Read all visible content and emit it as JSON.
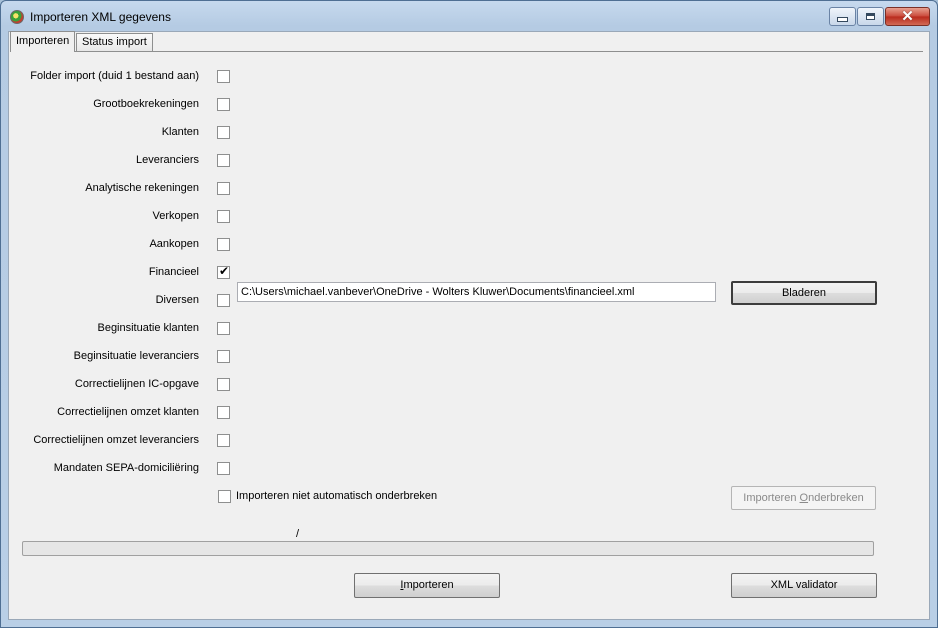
{
  "window": {
    "title": "Importeren XML gegevens",
    "icon": "app-globe-icon"
  },
  "tabs": [
    {
      "label": "Importeren",
      "active": true
    },
    {
      "label": "Status import",
      "active": false
    }
  ],
  "import_options": [
    {
      "label": "Folder import (duid 1 bestand aan)",
      "checked": false
    },
    {
      "label": "Grootboekrekeningen",
      "checked": false
    },
    {
      "label": "Klanten",
      "checked": false
    },
    {
      "label": "Leveranciers",
      "checked": false
    },
    {
      "label": "Analytische rekeningen",
      "checked": false
    },
    {
      "label": "Verkopen",
      "checked": false
    },
    {
      "label": "Aankopen",
      "checked": false
    },
    {
      "label": "Financieel",
      "checked": true
    },
    {
      "label": "Diversen",
      "checked": false
    },
    {
      "label": "Beginsituatie klanten",
      "checked": false
    },
    {
      "label": "Beginsituatie leveranciers",
      "checked": false
    },
    {
      "label": "Correctielijnen IC-opgave",
      "checked": false
    },
    {
      "label": "Correctielijnen omzet klanten",
      "checked": false
    },
    {
      "label": "Correctielijnen omzet leveranciers",
      "checked": false
    },
    {
      "label": "Mandaten SEPA-domiciliëring",
      "checked": false
    }
  ],
  "financieel_path": "C:\\Users\\michael.vanbever\\OneDrive - Wolters Kluwer\\Documents\\financieel.xml",
  "browse_button": "Bladeren",
  "no_auto_stop": {
    "label": "Importeren niet automatisch onderbreken",
    "checked": false
  },
  "stop_button": {
    "pre": "Importeren ",
    "mnemonic": "O",
    "post": "nderbreken"
  },
  "progress_counter": "/",
  "progress": 0,
  "import_button": {
    "mnemonic": "I",
    "post": "mporteren"
  },
  "validator_button": "XML validator"
}
